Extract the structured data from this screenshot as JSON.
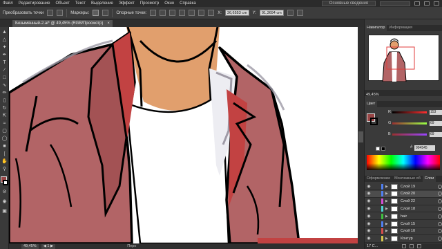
{
  "menu": {
    "items": [
      "Файл",
      "Редактирование",
      "Объект",
      "Текст",
      "Выделение",
      "Эффект",
      "Просмотр",
      "Окно",
      "Справка"
    ],
    "workspace": "Основные сведения"
  },
  "controlbar": {
    "label_transform": "Преобразовать точки",
    "label_markers": "Маркеры:",
    "label_anchor": "Опорные точки:",
    "x_value": "36,6553 cm",
    "y_value": "91,3694 cm"
  },
  "document": {
    "tab_title": "Безымянный-2.ai* @ 49,45% (RGB/Просмотр)",
    "close_symbol": "×"
  },
  "status": {
    "zoom": "49,45%",
    "tool_name": "Перо"
  },
  "navigator": {
    "tabs": [
      "Навигатор",
      "Информация"
    ],
    "zoom": "49,45%"
  },
  "color": {
    "title": "Цвет",
    "channels": [
      {
        "label": "R",
        "value": "153",
        "color": "#d9454f"
      },
      {
        "label": "G",
        "value": "69",
        "color": "#3fbf57"
      },
      {
        "label": "B",
        "value": "69",
        "color": "#4c6fe0"
      }
    ],
    "hex": "994545",
    "swatch": "#994545"
  },
  "layers": {
    "tabs": [
      "Оформление",
      "Монтажные об",
      "Слои"
    ],
    "items": [
      {
        "name": "Слой 19",
        "selected": false,
        "color": "#4f7ff0"
      },
      {
        "name": "Слой 20",
        "selected": true,
        "color": "#4f7ff0"
      },
      {
        "name": "Слой 22",
        "selected": false,
        "color": "#d44dd4"
      },
      {
        "name": "Слой 18",
        "selected": false,
        "color": "#4fd4d4"
      },
      {
        "name": "hair",
        "selected": false,
        "color": "#3fbf3f"
      },
      {
        "name": "Слой 15",
        "selected": false,
        "color": "#4f7ff0"
      },
      {
        "name": "Слой 10",
        "selected": false,
        "color": "#d44d4d"
      },
      {
        "name": "Контур",
        "selected": false,
        "color": "#d4c44d"
      }
    ],
    "count": "17 С..."
  },
  "colors": {
    "jacket": "#b26466",
    "jacket_shadow": "#c24242",
    "skin": "#e19f6d",
    "outline": "#000000",
    "shirt": "#ffffff",
    "shirt_shadow": "#9e9aa6"
  }
}
